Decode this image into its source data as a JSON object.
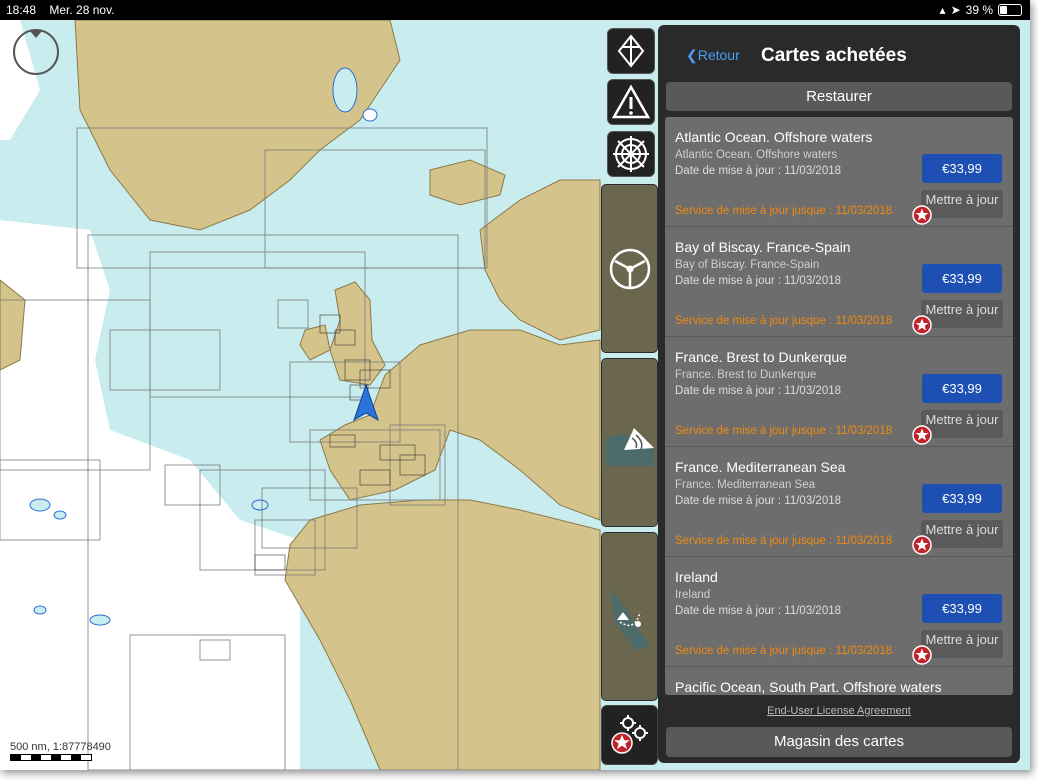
{
  "status": {
    "time": "18:48",
    "date": "Mer. 28 nov.",
    "battery": "39 %"
  },
  "map": {
    "scale_text": "500 nm, 1:87778490"
  },
  "panel": {
    "back_label": "Retour",
    "title": "Cartes achetées",
    "restore_label": "Restaurer",
    "items": [
      {
        "name": "Atlantic Ocean. Offshore waters",
        "subtitle": "Atlantic Ocean. Offshore waters",
        "date": "Date de mise à jour : 11/03/2018",
        "price": "€33,99",
        "service": "Service de mise à jour jusque : 11/03/2018",
        "update_label": "Mettre à jour"
      },
      {
        "name": "Bay of Biscay. France-Spain",
        "subtitle": "Bay of Biscay. France-Spain",
        "date": "Date de mise à jour : 11/03/2018",
        "price": "€33,99",
        "service": "Service de mise à jour jusque : 11/03/2018",
        "update_label": "Mettre à jour"
      },
      {
        "name": "France. Brest to Dunkerque",
        "subtitle": "France. Brest to Dunkerque",
        "date": "Date de mise à jour : 11/03/2018",
        "price": "€33,99",
        "service": "Service de mise à jour jusque : 11/03/2018",
        "update_label": "Mettre à jour"
      },
      {
        "name": "France. Mediterranean Sea",
        "subtitle": "France. Mediterranean Sea",
        "date": "Date de mise à jour : 11/03/2018",
        "price": "€33,99",
        "service": "Service de mise à jour jusque : 11/03/2018",
        "update_label": "Mettre à jour"
      },
      {
        "name": "Ireland",
        "subtitle": "Ireland",
        "date": "Date de mise à jour : 11/03/2018",
        "price": "€33,99",
        "service": "Service de mise à jour jusque : 11/03/2018",
        "update_label": "Mettre à jour"
      },
      {
        "name": "Pacific Ocean, South Part. Offshore waters",
        "subtitle": "",
        "date": "",
        "price": "",
        "service": "",
        "update_label": ""
      }
    ],
    "eula_label": "End-User License Agreement",
    "store_label": "Magasin des cartes"
  },
  "colors": {
    "land": "#d4c48c",
    "sea": "#c9ecee",
    "deep": "#ffffff",
    "price_button": "#1e4fb3",
    "service_text": "#f08a12",
    "link": "#4a9df8"
  },
  "icons": [
    "compass-rose-icon",
    "route-icon",
    "warning-icon",
    "ship-wheel-icon",
    "steering-wheel-icon",
    "sonar-icon",
    "track-route-icon",
    "settings-star-icon"
  ]
}
